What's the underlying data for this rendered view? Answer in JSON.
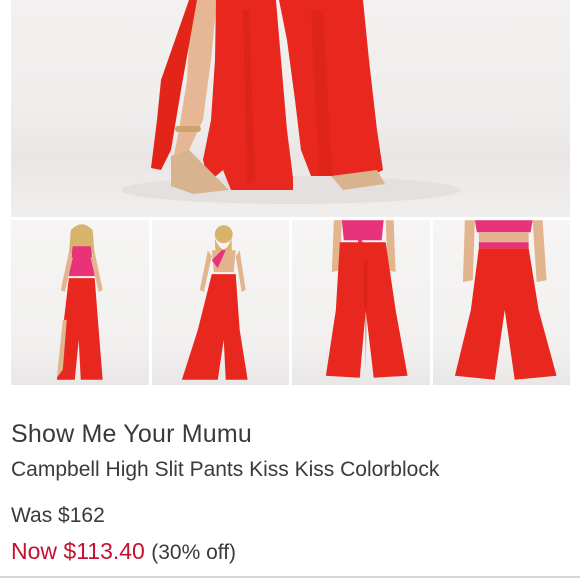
{
  "listing": {
    "brand": "Show Me Your Mumu",
    "title": "Campbell High Slit Pants Kiss Kiss Colorblock",
    "was_price": "Was $162",
    "now_price": "Now $113.40",
    "discount": "(30% off)"
  },
  "gallery": {
    "thumbnails": [
      {
        "view": "front-pose"
      },
      {
        "view": "back-pose"
      },
      {
        "view": "front-closeup"
      },
      {
        "view": "back-closeup"
      }
    ]
  },
  "colors": {
    "garment": "#e8281e",
    "top": "#e8327a",
    "price_sale": "#c8102e"
  }
}
